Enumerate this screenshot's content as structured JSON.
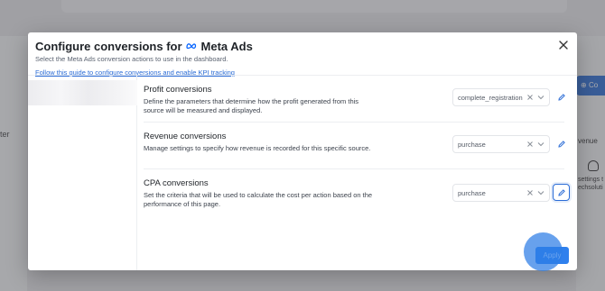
{
  "background": {
    "left_text": "ter",
    "right_button_label": "Co",
    "right_heading": "venue",
    "right_line1": "settings t",
    "right_line2": "echsoluti"
  },
  "modal": {
    "title_prefix": "Configure conversions for",
    "brand_name": "Meta Ads",
    "subtitle": "Select the Meta Ads conversion actions to use in the dashboard.",
    "link": "Follow this guide to configure conversions and enable KPI tracking",
    "sections": [
      {
        "title": "Profit conversions",
        "description": "Define the parameters that determine how the profit generated from this source will be measured and displayed.",
        "selected": "complete_registration"
      },
      {
        "title": "Revenue conversions",
        "description": "Manage settings to specify how revenue is recorded for this specific source.",
        "selected": "purchase"
      },
      {
        "title": "CPA conversions",
        "description": "Set the criteria that will be used to calculate the cost per action based on the performance of this page.",
        "selected": "purchase"
      }
    ],
    "apply_label": "Apply"
  },
  "colors": {
    "accent": "#2f80ed",
    "link": "#2b6cd6",
    "meta_blue": "#0866ff"
  },
  "icons": {
    "close": "close-icon",
    "clear": "clear-x-icon",
    "chevron": "chevron-down-icon",
    "edit": "pencil-icon",
    "brand": "meta-logo-icon"
  }
}
